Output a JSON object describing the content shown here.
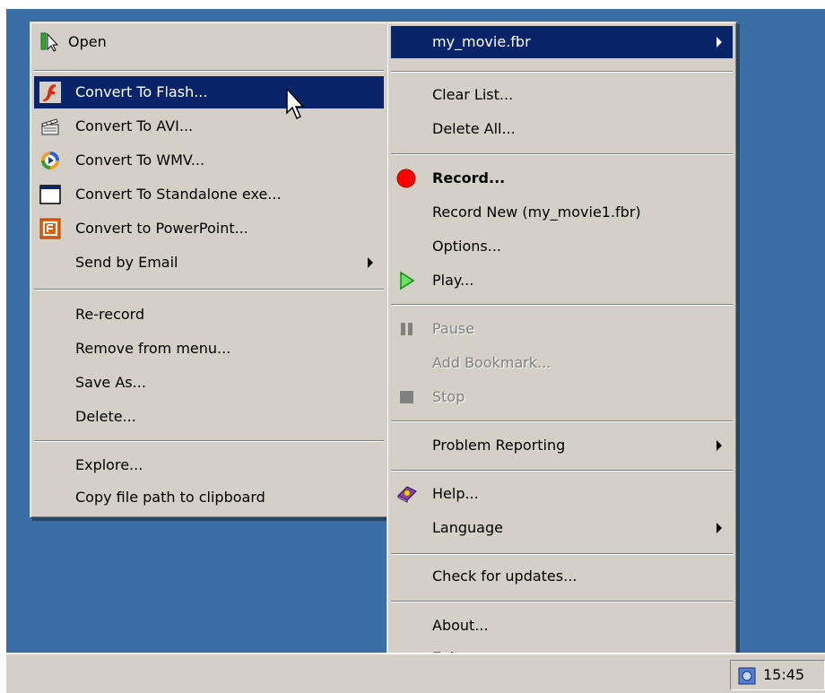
{
  "left_menu": {
    "items": [
      {
        "label": "Open",
        "icon": "open-cursor-icon"
      },
      {
        "label": "Convert To Flash...",
        "icon": "flash-icon"
      },
      {
        "label": "Convert To AVI...",
        "icon": "clapperboard-icon"
      },
      {
        "label": "Convert To WMV...",
        "icon": "wmv-icon"
      },
      {
        "label": "Convert To Standalone exe...",
        "icon": "window-exe-icon"
      },
      {
        "label": "Convert to PowerPoint...",
        "icon": "powerpoint-icon"
      },
      {
        "label": "Send by Email",
        "icon": "submenu-arrow"
      },
      {
        "label": "Re-record"
      },
      {
        "label": "Remove from menu..."
      },
      {
        "label": "Save As..."
      },
      {
        "label": "Delete..."
      },
      {
        "label": "Explore..."
      },
      {
        "label": "Copy file path to clipboard"
      }
    ]
  },
  "right_menu": {
    "items": [
      {
        "label": "my_movie.fbr",
        "selected": true
      },
      {
        "label": "Clear List..."
      },
      {
        "label": "Delete All..."
      },
      {
        "label": "Record...",
        "icon": "record-icon"
      },
      {
        "label": "Record New (my_movie1.fbr)"
      },
      {
        "label": "Options..."
      },
      {
        "label": "Play...",
        "icon": "play-icon"
      },
      {
        "label": "Pause",
        "icon": "pause-icon",
        "disabled": true
      },
      {
        "label": "Add Bookmark...",
        "disabled": true
      },
      {
        "label": "Stop",
        "icon": "stop-icon",
        "disabled": true
      },
      {
        "label": "Problem Reporting"
      },
      {
        "label": "Help...",
        "icon": "help-book-icon"
      },
      {
        "label": "Language"
      },
      {
        "label": "Check for updates..."
      },
      {
        "label": "About..."
      },
      {
        "label": "Exit"
      }
    ]
  },
  "taskbar": {
    "clock": "15:45"
  },
  "colors": {
    "desktop": "#3a6ea5",
    "menu_bg": "#d4d0c8",
    "selection": "#0a246a",
    "record_red": "#ff0000",
    "play_green": "#22c022"
  }
}
